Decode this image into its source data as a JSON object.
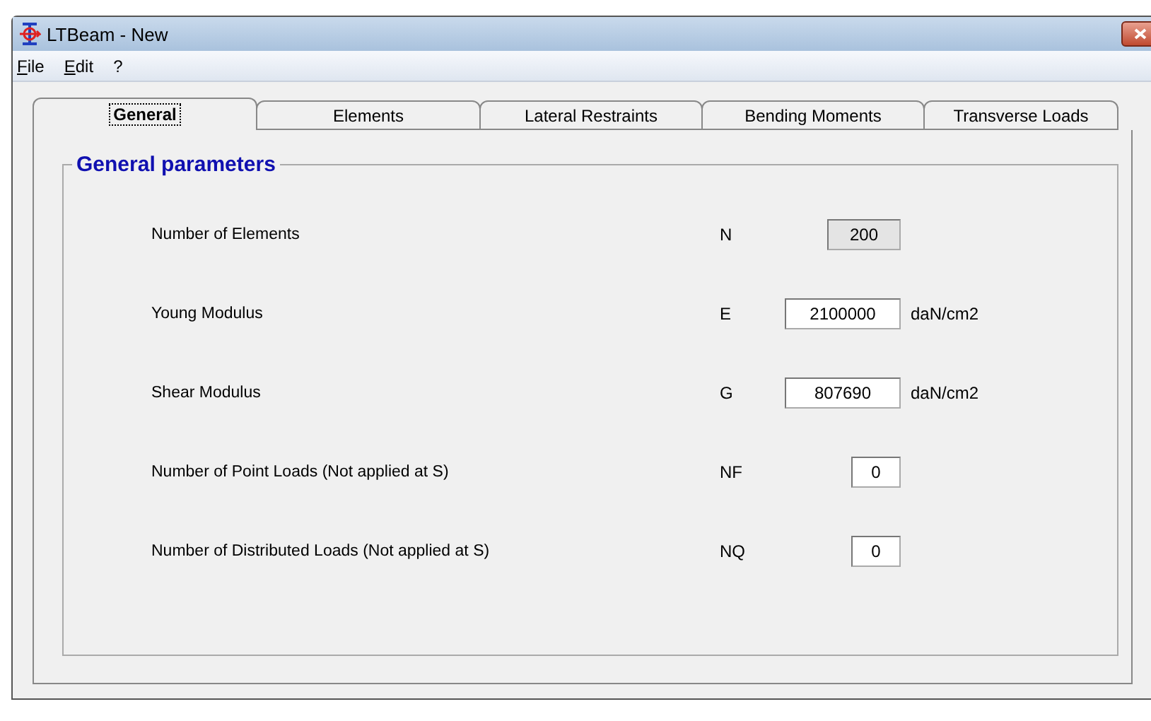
{
  "window": {
    "title": "LTBeam - New"
  },
  "menu": [
    {
      "label": "File",
      "underlined": true
    },
    {
      "label": "Edit",
      "underlined": true
    },
    {
      "label": "?",
      "underlined": false
    }
  ],
  "tabs": [
    {
      "label": "General",
      "selected": true
    },
    {
      "label": "Elements",
      "selected": false
    },
    {
      "label": "Lateral Restraints",
      "selected": false
    },
    {
      "label": "Bending Moments",
      "selected": false
    },
    {
      "label": "Transverse Loads",
      "selected": false
    }
  ],
  "group": {
    "title": "General parameters"
  },
  "parameters": [
    {
      "label": "Number of Elements",
      "symbol": "N",
      "value": "200",
      "kind": "readonly"
    },
    {
      "label": "Young Modulus",
      "symbol": "E",
      "value": "2100000",
      "unit": "daN/cm2",
      "kind": "wide"
    },
    {
      "label": "Shear Modulus",
      "symbol": "G",
      "value": "807690",
      "unit": "daN/cm2",
      "kind": "wide"
    },
    {
      "label": "Number of Point Loads (Not applied at S)",
      "symbol": "NF",
      "value": "0",
      "kind": "narrow"
    },
    {
      "label": "Number of Distributed Loads (Not applied at S)",
      "symbol": "NQ",
      "value": "0",
      "kind": "narrow"
    }
  ]
}
